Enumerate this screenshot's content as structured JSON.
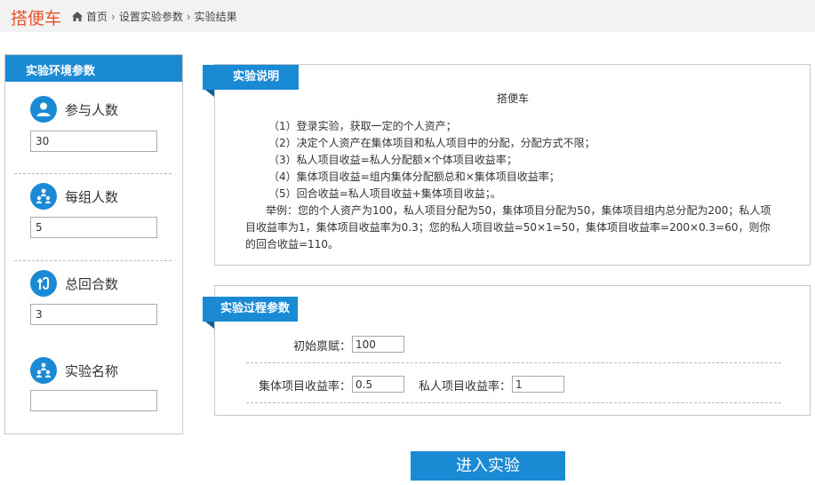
{
  "header": {
    "brand": "搭便车",
    "breadcrumb": [
      "首页",
      "设置实验参数",
      "实验结果"
    ]
  },
  "left_panel": {
    "title": "实验环境参数",
    "params": [
      {
        "label": "参与人数",
        "value": "30",
        "icon": "user-icon"
      },
      {
        "label": "每组人数",
        "value": "5",
        "icon": "group-icon"
      },
      {
        "label": "总回合数",
        "value": "3",
        "icon": "rounds-icon"
      },
      {
        "label": "实验名称",
        "value": "",
        "icon": "group-icon"
      }
    ]
  },
  "description": {
    "ribbon": "实验说明",
    "title": "搭便车",
    "rules": [
      "（1）登录实验，获取一定的个人资产；",
      "（2）决定个人资产在集体项目和私人项目中的分配，分配方式不限；",
      "（3）私人项目收益=私人分配额×个体项目收益率；",
      "（4）集体项目收益=组内集体分配额总和×集体项目收益率；",
      "（5）回合收益=私人项目收益+集体项目收益；。"
    ],
    "example": "举例：您的个人资产为100，私人项目分配为50，集体项目分配为50，集体项目组内总分配为200；私人项目收益率为1，集体项目收益率为0.3；您的私人项目收益=50×1=50，集体项目收益率=200×0.3=60，则你的回合收益=110。"
  },
  "process": {
    "ribbon": "实验过程参数",
    "initial_label": "初始禀赋：",
    "initial_value": "100",
    "collective_label": "集体项目收益率：",
    "collective_value": "0.5",
    "private_label": "私人项目收益率：",
    "private_value": "1"
  },
  "actions": {
    "enter_label": "进入实验"
  },
  "colors": {
    "accent": "#1a8ad4",
    "brand": "#e8542a"
  }
}
